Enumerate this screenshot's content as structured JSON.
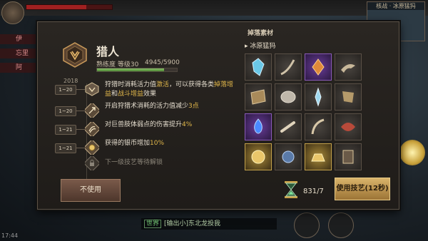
{
  "hud": {
    "side_items": [
      "伊",
      "忘里",
      "阿"
    ],
    "map_title": "核战 · 冰原猛犸",
    "chat_channel": "世界",
    "chat_text": "[输出小]东北龙投我",
    "time": "17:44"
  },
  "profession": {
    "name": "猎人",
    "level_label": "熟练度 等级30",
    "exp_text": "4945/5900",
    "exp_fraction": 0.838,
    "year": "2018"
  },
  "skills": [
    {
      "level": "1~20",
      "icon": "hunter-badge-icon",
      "parts": [
        {
          "t": "狩猎时消耗活力值"
        },
        {
          "t": "激活",
          "hl": true
        },
        {
          "t": "，可以获得各类"
        },
        {
          "t": "掉落增益",
          "hl": true
        },
        {
          "t": "和"
        },
        {
          "t": "战斗增益",
          "hl": true
        },
        {
          "t": "效果"
        }
      ]
    },
    {
      "level": "1~20",
      "icon": "arrow-skill-icon",
      "parts": [
        {
          "t": "开启狩猎术消耗的活力值减少"
        },
        {
          "t": "3点",
          "hl": true
        }
      ]
    },
    {
      "level": "1~21",
      "icon": "claw-skill-icon",
      "parts": [
        {
          "t": "对巨兽肢体弱点的伤害提升"
        },
        {
          "t": "4%",
          "hl": true
        }
      ]
    },
    {
      "level": "1~21",
      "icon": "coin-skill-icon",
      "parts": [
        {
          "t": "获得的银币增加"
        },
        {
          "t": "10%",
          "hl": true
        }
      ]
    },
    {
      "level": "",
      "icon": "lock-icon",
      "locked": true,
      "parts": [
        {
          "t": "下一级技艺等待解锁"
        }
      ]
    }
  ],
  "disable_button": "不使用",
  "loot": {
    "title": "掉落素材",
    "target": "冰原猛犸",
    "items": [
      {
        "name": "ice-crystal-icon",
        "rarity": "grey"
      },
      {
        "name": "tusk-icon",
        "rarity": "grey"
      },
      {
        "name": "fire-shard-icon",
        "rarity": "purple"
      },
      {
        "name": "bone-claw-icon",
        "rarity": "grey"
      },
      {
        "name": "hide-icon",
        "rarity": "grey"
      },
      {
        "name": "shell-icon",
        "rarity": "grey"
      },
      {
        "name": "frost-spike-icon",
        "rarity": "grey"
      },
      {
        "name": "hide-scrap-icon",
        "rarity": "grey"
      },
      {
        "name": "blue-flame-icon",
        "rarity": "purple"
      },
      {
        "name": "bone-icon",
        "rarity": "grey"
      },
      {
        "name": "horn-icon",
        "rarity": "grey"
      },
      {
        "name": "red-fur-icon",
        "rarity": "grey"
      },
      {
        "name": "gold-ore-icon",
        "rarity": "gold"
      },
      {
        "name": "orb-icon",
        "rarity": "grey"
      },
      {
        "name": "gold-ingot-icon",
        "rarity": "gold"
      },
      {
        "name": "rune-icon",
        "rarity": "grey"
      }
    ]
  },
  "stamina": "831/7",
  "use_button": "使用技艺(12秒)",
  "colors": {
    "highlight": "#e0b64a",
    "panel": "#2a2622",
    "use_button": "#d9b36a"
  }
}
